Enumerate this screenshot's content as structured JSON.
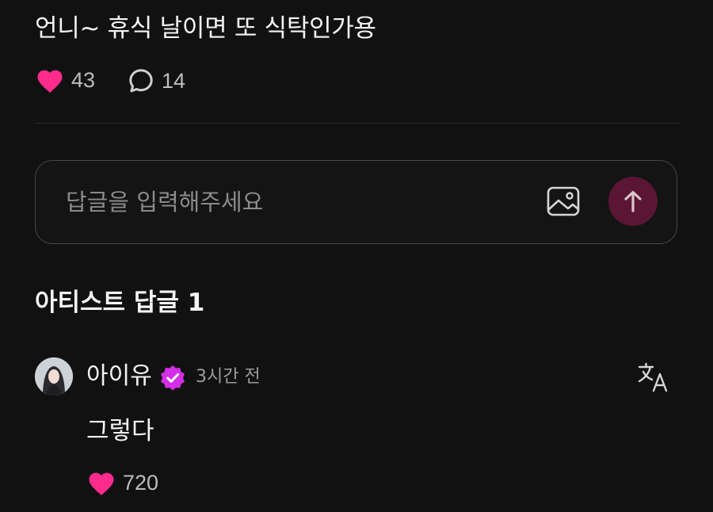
{
  "post": {
    "text": "언니~ 휴식 날이면 또 식탁인가용",
    "likes": "43",
    "comments": "14"
  },
  "reply_box": {
    "placeholder": "답글을 입력해주세요"
  },
  "artist_replies": {
    "title": "아티스트 답글 1",
    "items": [
      {
        "author": "아이유",
        "time": "3시간 전",
        "text": "그렇다",
        "likes": "720"
      }
    ]
  },
  "colors": {
    "background": "#121112",
    "heart": "#ff2c8e",
    "verified_badge": "#d42fe6",
    "send_button": "#5b1634"
  },
  "icons": [
    "heart-icon",
    "comment-bubble-icon",
    "image-icon",
    "arrow-up-icon",
    "verified-badge-icon",
    "translate-icon"
  ]
}
